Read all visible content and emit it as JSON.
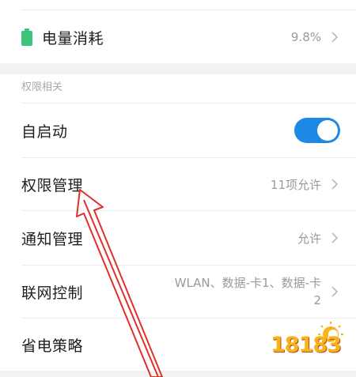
{
  "battery_row": {
    "label": "电量消耗",
    "value": "9.8%"
  },
  "permissions_section": {
    "header": "权限相关",
    "rows": [
      {
        "label": "自启动",
        "toggle_on": true
      },
      {
        "label": "权限管理",
        "value": "11项允许"
      },
      {
        "label": "通知管理",
        "value": "允许"
      },
      {
        "label": "联网控制",
        "value_line1": "WLAN、数据-卡1、数据-卡",
        "value_line2": "2"
      },
      {
        "label": "省电策略"
      }
    ]
  },
  "watermark": {
    "text": "18183"
  },
  "colors": {
    "accent": "#1e88e5",
    "battery": "#3cc47a",
    "annotation_arrow": "#e0302a"
  }
}
